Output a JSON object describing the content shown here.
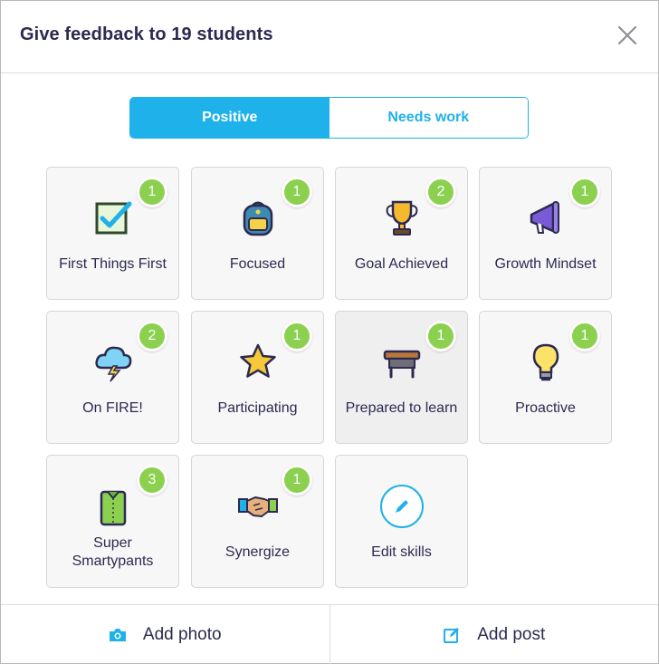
{
  "header": {
    "title": "Give feedback to 19 students",
    "close_icon": "close-icon"
  },
  "toggle": {
    "positive_label": "Positive",
    "needs_work_label": "Needs work",
    "active": "positive",
    "accent_color": "#1fb1e9"
  },
  "skills": [
    {
      "label": "First Things First",
      "count": "1",
      "icon": "checkbox-icon"
    },
    {
      "label": "Focused",
      "count": "1",
      "icon": "backpack-icon"
    },
    {
      "label": "Goal Achieved",
      "count": "2",
      "icon": "trophy-icon"
    },
    {
      "label": "Growth Mindset",
      "count": "1",
      "icon": "megaphone-icon"
    },
    {
      "label": "On FIRE!",
      "count": "2",
      "icon": "storm-cloud-icon"
    },
    {
      "label": "Participating",
      "count": "1",
      "icon": "star-icon"
    },
    {
      "label": "Prepared to learn",
      "count": "1",
      "icon": "desk-icon"
    },
    {
      "label": "Proactive",
      "count": "1",
      "icon": "lightbulb-icon"
    },
    {
      "label": "Super Smartypants",
      "count": "3",
      "icon": "shirt-icon"
    },
    {
      "label": "Synergize",
      "count": "1",
      "icon": "handshake-icon"
    },
    {
      "label": "Edit skills",
      "count": null,
      "icon": "pencil-icon"
    }
  ],
  "badge_color": "#8bd14f",
  "footer": {
    "add_photo_label": "Add photo",
    "add_photo_icon": "camera-icon",
    "add_post_label": "Add post",
    "add_post_icon": "edit-note-icon"
  }
}
